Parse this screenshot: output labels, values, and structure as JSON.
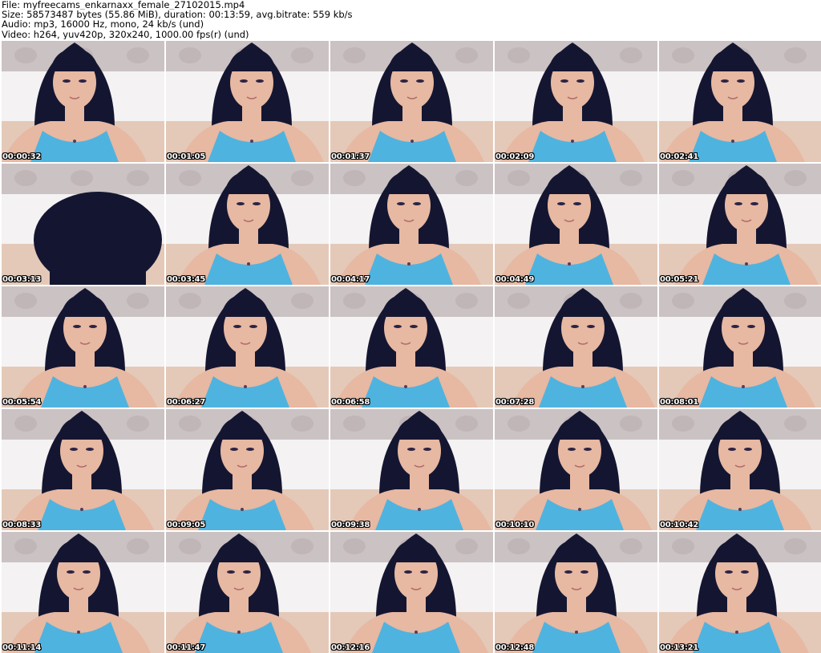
{
  "header": {
    "file_line": "File: myfreecams_enkarnaxx_female_27102015.mp4",
    "size_line": "Size: 58573487 bytes (55.86 MiB), duration: 00:13:59, avg.bitrate: 559 kb/s",
    "audio_line": "Audio: mp3, 16000 Hz, mono, 24 kb/s (und)",
    "video_line": "Video: h264, yuv420p, 320x240, 1000.00 fps(r) (und)"
  },
  "colors": {
    "wall": "#cbc2c3",
    "headboard": "#f4f2f3",
    "hair": "#141631",
    "skin": "#e7b8a2",
    "top": "#4fb3df",
    "bed": "#e4c9b8"
  },
  "thumbnails": [
    {
      "timestamp": "00:00:32",
      "pose": "normal"
    },
    {
      "timestamp": "00:01:05",
      "pose": "normal"
    },
    {
      "timestamp": "00:01:37",
      "pose": "normal"
    },
    {
      "timestamp": "00:02:09",
      "pose": "normal"
    },
    {
      "timestamp": "00:02:41",
      "pose": "normal"
    },
    {
      "timestamp": "00:03:13",
      "pose": "close"
    },
    {
      "timestamp": "00:03:45",
      "pose": "normal"
    },
    {
      "timestamp": "00:04:17",
      "pose": "normal"
    },
    {
      "timestamp": "00:04:49",
      "pose": "normal"
    },
    {
      "timestamp": "00:05:21",
      "pose": "normal"
    },
    {
      "timestamp": "00:05:54",
      "pose": "normal"
    },
    {
      "timestamp": "00:06:27",
      "pose": "normal"
    },
    {
      "timestamp": "00:06:58",
      "pose": "normal"
    },
    {
      "timestamp": "00:07:28",
      "pose": "normal"
    },
    {
      "timestamp": "00:08:01",
      "pose": "normal"
    },
    {
      "timestamp": "00:08:33",
      "pose": "normal"
    },
    {
      "timestamp": "00:09:05",
      "pose": "normal"
    },
    {
      "timestamp": "00:09:38",
      "pose": "normal"
    },
    {
      "timestamp": "00:10:10",
      "pose": "normal"
    },
    {
      "timestamp": "00:10:42",
      "pose": "normal"
    },
    {
      "timestamp": "00:11:14",
      "pose": "normal"
    },
    {
      "timestamp": "00:11:47",
      "pose": "normal"
    },
    {
      "timestamp": "00:12:16",
      "pose": "normal"
    },
    {
      "timestamp": "00:12:48",
      "pose": "normal"
    },
    {
      "timestamp": "00:13:21",
      "pose": "normal"
    }
  ]
}
